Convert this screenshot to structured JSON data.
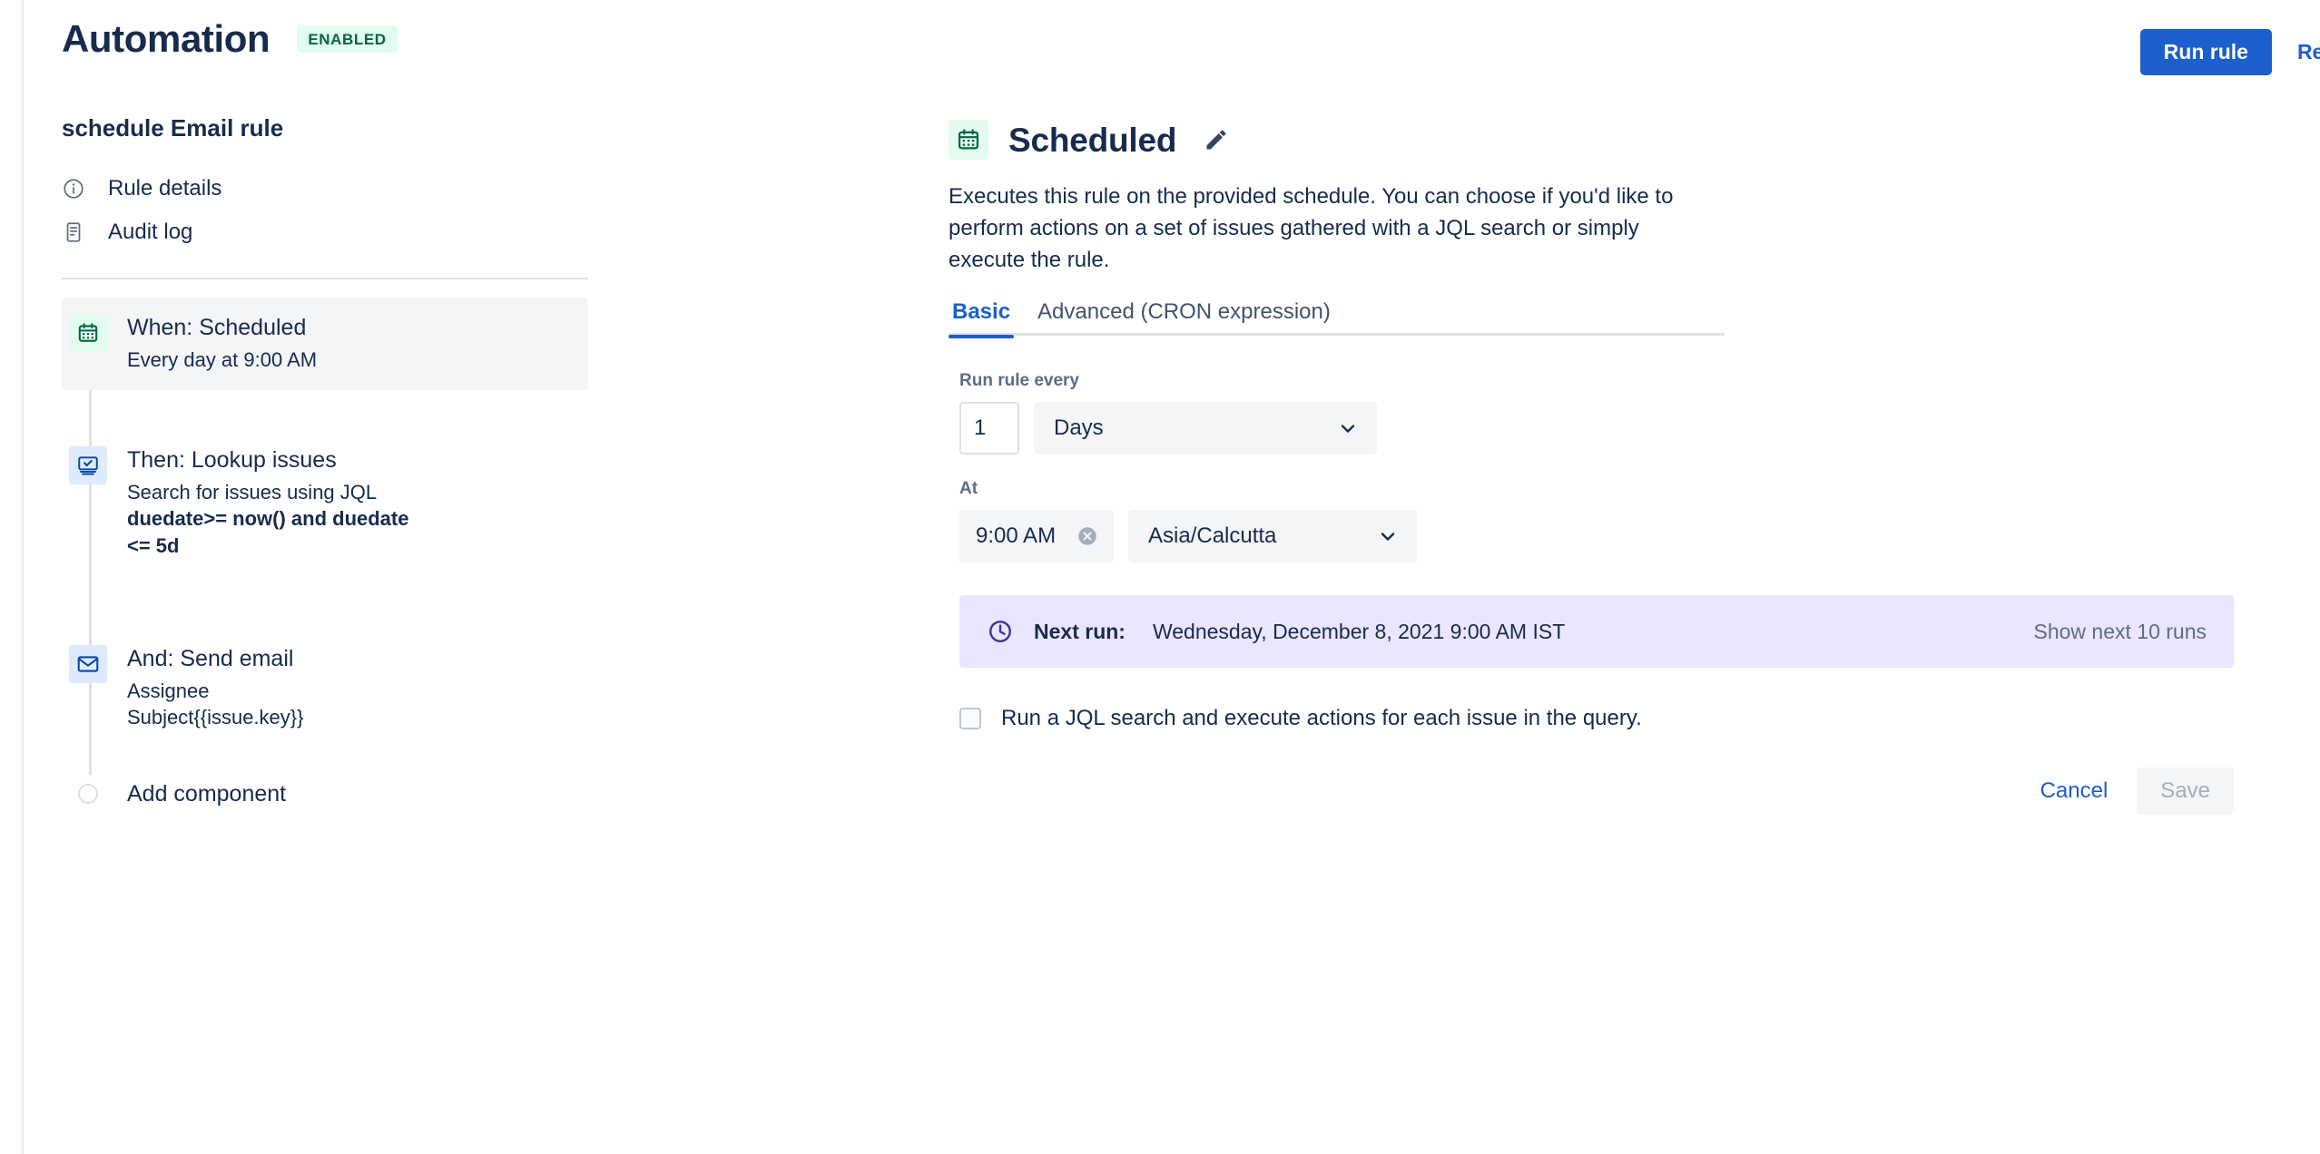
{
  "header": {
    "title": "Automation",
    "status": "ENABLED",
    "run_rule_label": "Run rule",
    "return_label": "Ret"
  },
  "sidebar": {
    "rule_name": "schedule Email rule",
    "nav": [
      {
        "label": "Rule details",
        "icon": "info-icon"
      },
      {
        "label": "Audit log",
        "icon": "document-icon"
      }
    ],
    "components": [
      {
        "title": "When: Scheduled",
        "subtitle": "Every day at 9:00 AM",
        "icon": "calendar-icon",
        "selected": true
      },
      {
        "title": "Then: Lookup issues",
        "subtitle": "Search for issues using JQL",
        "jql": "duedate>= now() and duedate <= 5d",
        "icon": "lookup-issues-icon",
        "selected": false
      },
      {
        "title": "And: Send email",
        "subtitle_line1": "Assignee",
        "subtitle_line2": "Subject{{issue.key}}",
        "icon": "envelope-icon",
        "selected": false
      }
    ],
    "add_component_label": "Add component"
  },
  "main": {
    "title": "Scheduled",
    "description": "Executes this rule on the provided schedule. You can choose if you'd like to perform actions on a set of issues gathered with a JQL search or simply execute the rule.",
    "tabs": [
      {
        "label": "Basic",
        "active": true
      },
      {
        "label": "Advanced (CRON expression)",
        "active": false
      }
    ],
    "run_rule_every": {
      "label": "Run rule every",
      "interval_value": "1",
      "unit_value": "Days"
    },
    "at": {
      "label": "At",
      "time_value": "9:00 AM",
      "timezone_value": "Asia/Calcutta"
    },
    "next_run": {
      "label": "Next run:",
      "value": "Wednesday, December 8, 2021 9:00 AM IST",
      "action": "Show next 10 runs"
    },
    "jql_checkbox_label": "Run a JQL search and execute actions for each issue in the query.",
    "cancel_label": "Cancel",
    "save_label": "Save"
  },
  "colors": {
    "brand_blue": "#1B5FCC",
    "success_green": "#006644",
    "success_bg": "#E3FCEF",
    "banner_purple_bg": "#EAE6FF",
    "text": "#172B4D",
    "subtle_text": "#5E6C84"
  }
}
